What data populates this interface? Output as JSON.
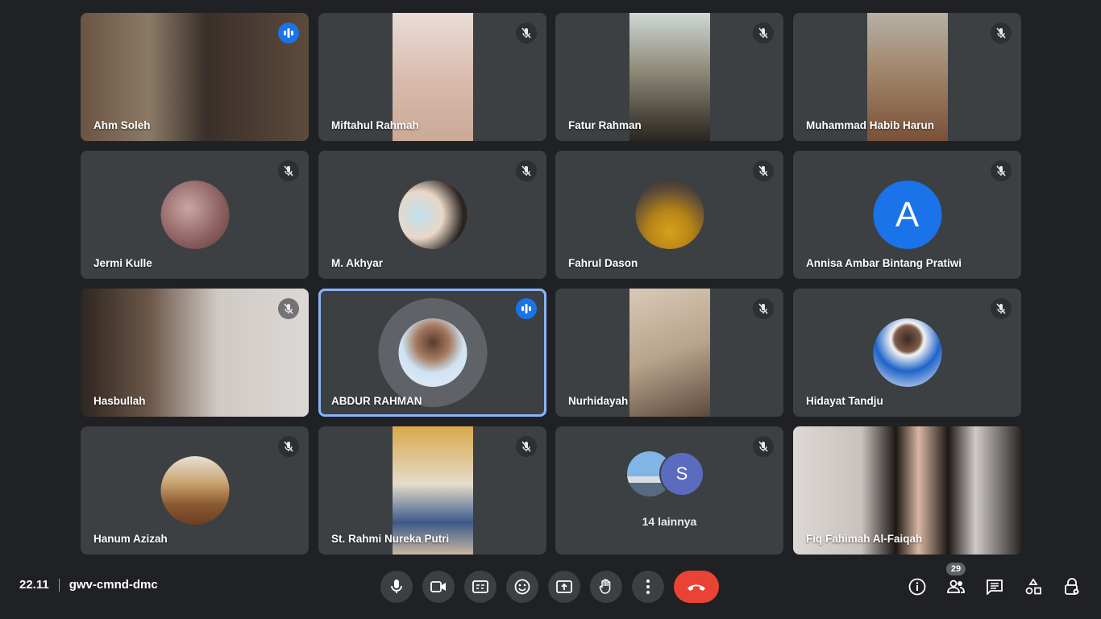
{
  "participants": [
    {
      "name": "Ahm Soleh",
      "status": "speaking"
    },
    {
      "name": "Miftahul Rahmah",
      "status": "muted"
    },
    {
      "name": "Fatur Rahman",
      "status": "muted"
    },
    {
      "name": "Muhammad Habib Harun",
      "status": "muted"
    },
    {
      "name": "Jermi Kulle",
      "status": "muted"
    },
    {
      "name": "M. Akhyar",
      "status": "muted"
    },
    {
      "name": "Fahrul Dason",
      "status": "muted"
    },
    {
      "name": "Annisa Ambar Bintang Pratiwi",
      "status": "muted",
      "initial": "A"
    },
    {
      "name": "Hasbullah",
      "status": "muted"
    },
    {
      "name": "ABDUR RAHMAN",
      "status": "speaking"
    },
    {
      "name": "Nurhidayah",
      "status": "muted"
    },
    {
      "name": "Hidayat Tandju",
      "status": "muted"
    },
    {
      "name": "Hanum Azizah",
      "status": "muted"
    },
    {
      "name": "St. Rahmi Nureka Putri",
      "status": "muted"
    }
  ],
  "more": {
    "initial": "S",
    "label": "14 lainnya"
  },
  "last_tile": {
    "name": "Fiq Fahimah Al-Faiqah"
  },
  "meeting": {
    "time": "22.11",
    "code": "gwv-cmnd-dmc",
    "participant_count": "29"
  },
  "colors": {
    "background": "#202124",
    "tile": "#3c4043",
    "accent": "#1a73e8",
    "end_call": "#ea4335",
    "active_outline": "#8ab4f8"
  },
  "controls": [
    "microphone-icon",
    "camera-icon",
    "captions-icon",
    "emoji-icon",
    "present-screen-icon",
    "raise-hand-icon",
    "more-options-icon",
    "end-call-icon"
  ],
  "right_controls": [
    "info-icon",
    "people-icon",
    "chat-icon",
    "activities-icon",
    "host-controls-icon"
  ]
}
